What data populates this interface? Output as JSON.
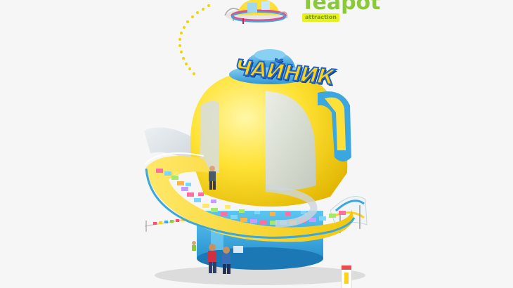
{
  "brand": {
    "title": "Teapot",
    "tagline": "attraction"
  },
  "sign": {
    "text": "ЧАЙНИК"
  },
  "colors": {
    "background": "#f6f6f6",
    "teapot_yellow": "#ffe03a",
    "teapot_blue": "#3aa7e0",
    "brand_green": "#8cc83c",
    "tag_yellow": "#e7ef1c"
  }
}
